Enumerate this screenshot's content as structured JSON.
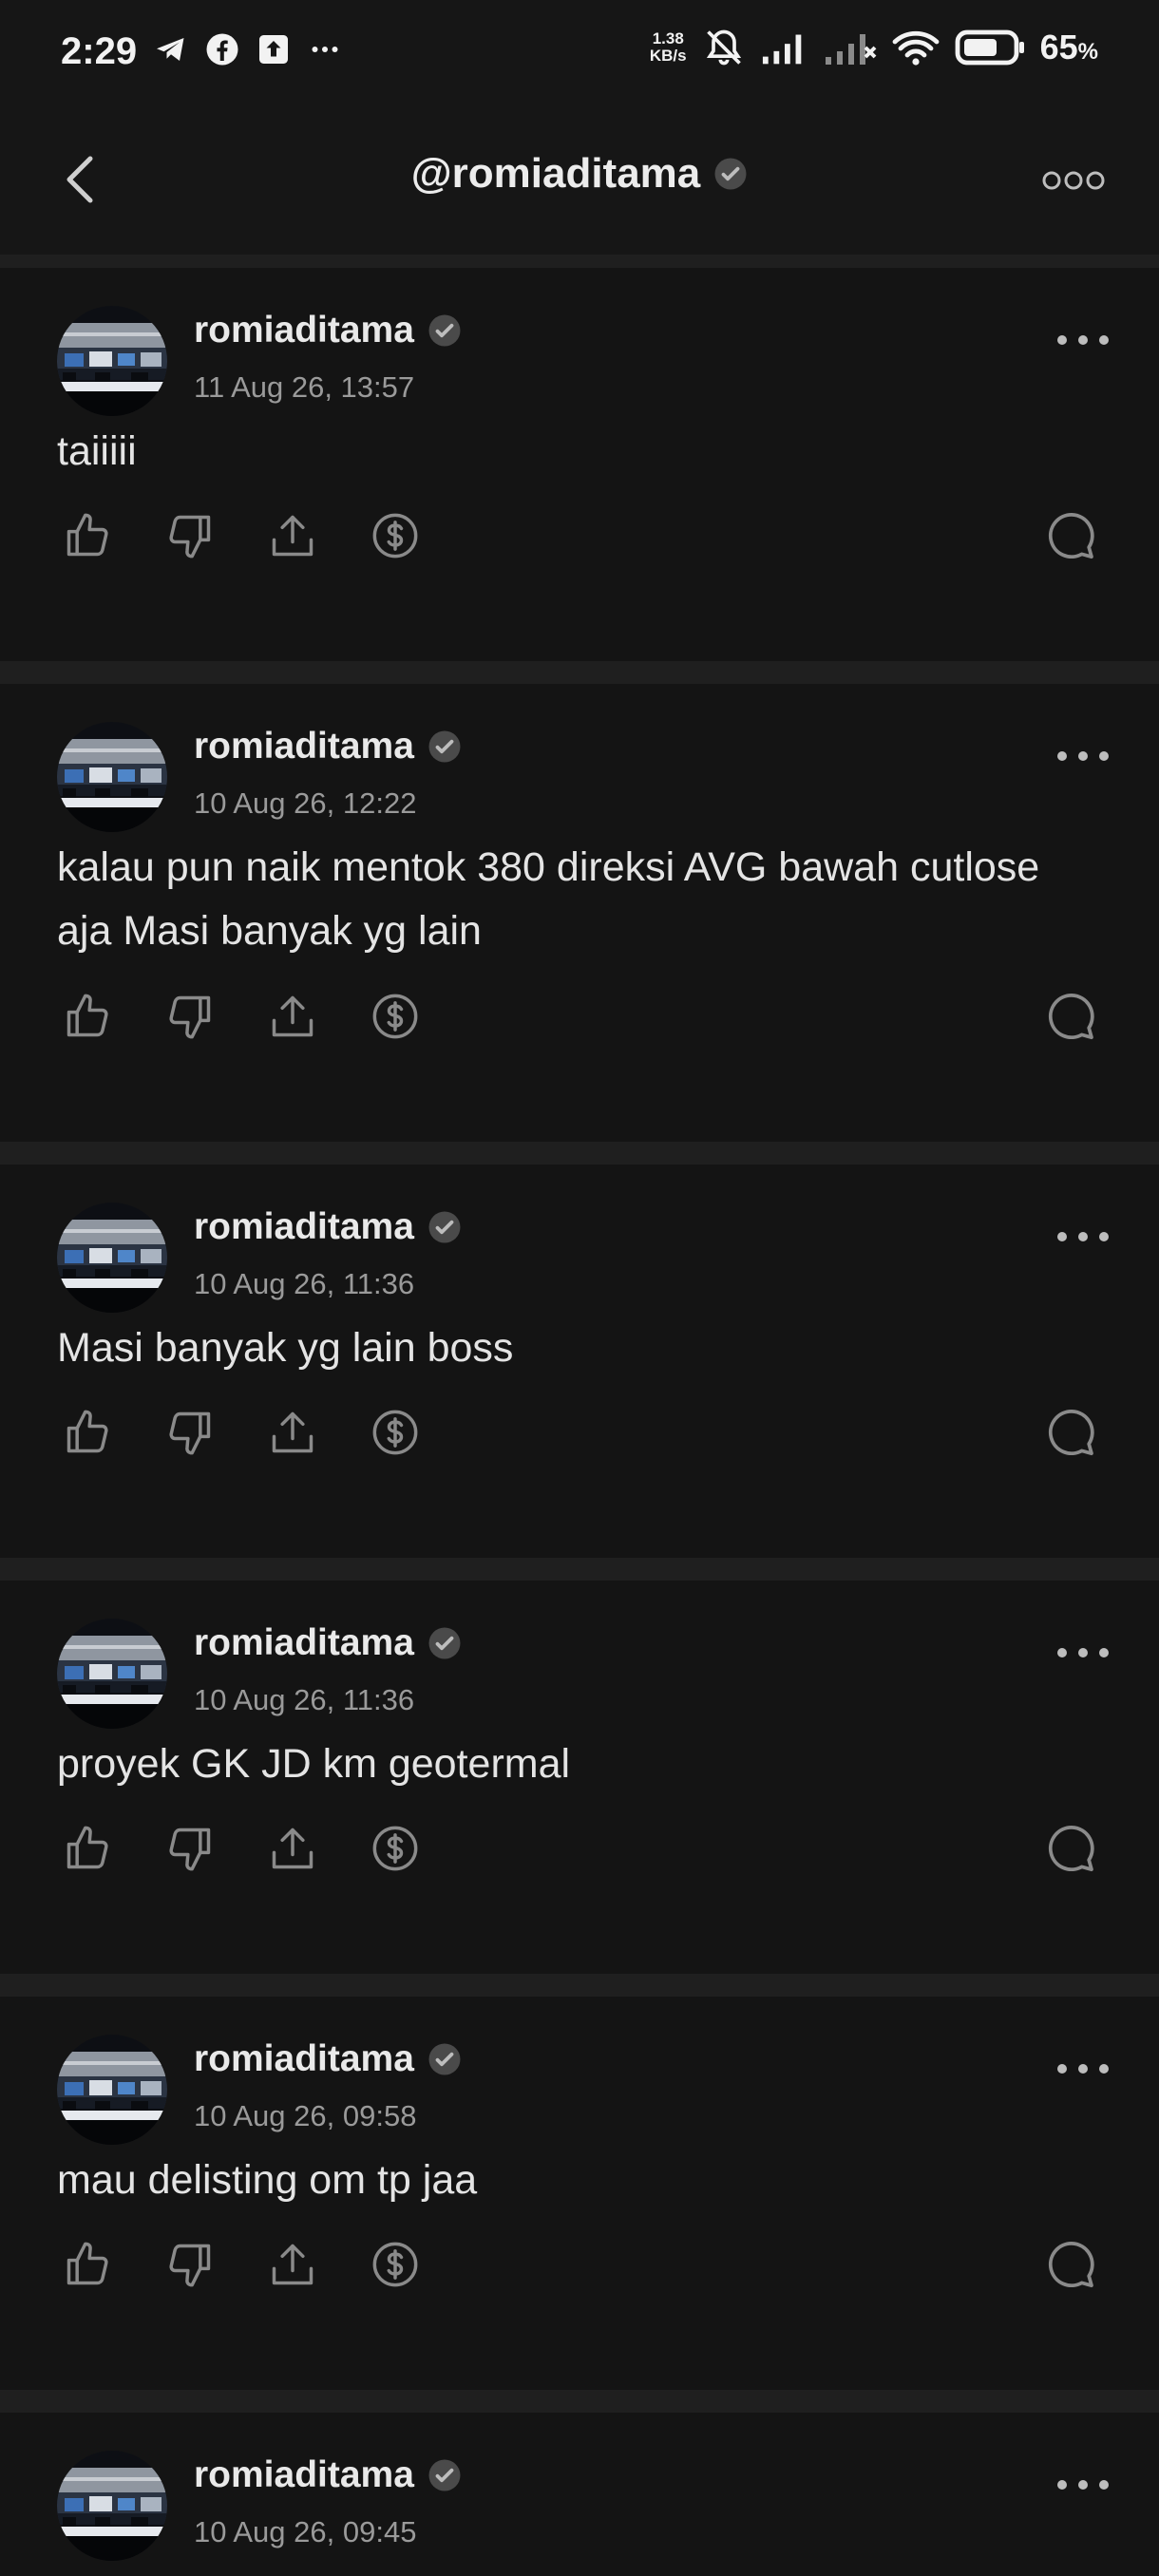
{
  "status_bar": {
    "time": "2:29",
    "net_speed_value": "1.38",
    "net_speed_unit": "KB/s",
    "battery_percent": "65",
    "battery_symbol": "%",
    "left_icons": [
      "telegram-icon",
      "facebook-icon",
      "upload-notification-icon",
      "more-notifications-icon"
    ],
    "right_icons": [
      "notifications-muted-icon",
      "signal-icon",
      "signal-no-service-icon",
      "wifi-icon",
      "battery-icon"
    ]
  },
  "header": {
    "title": "@romiaditama",
    "verified": true
  },
  "posts": [
    {
      "username": "romiaditama",
      "time": "11 Aug 26, 13:57",
      "text": "taiiiii"
    },
    {
      "username": "romiaditama",
      "time": "10 Aug 26, 12:22",
      "text": "kalau pun naik mentok 380 direksi AVG bawah cutlose aja Masi banyak yg lain"
    },
    {
      "username": "romiaditama",
      "time": "10 Aug 26, 11:36",
      "text": "Masi banyak yg lain boss"
    },
    {
      "username": "romiaditama",
      "time": "10 Aug 26, 11:36",
      "text": "proyek GK JD km geotermal"
    },
    {
      "username": "romiaditama",
      "time": "10 Aug 26, 09:58",
      "text": "mau delisting om tp jaa"
    },
    {
      "username": "romiaditama",
      "time": "10 Aug 26, 09:45",
      "text": ""
    }
  ],
  "colors": {
    "background": "#141414",
    "divider": "#1f1f1f",
    "text_primary": "#e6e6e6",
    "text_secondary": "#9a9a9a",
    "icon": "#8a8a8a"
  }
}
